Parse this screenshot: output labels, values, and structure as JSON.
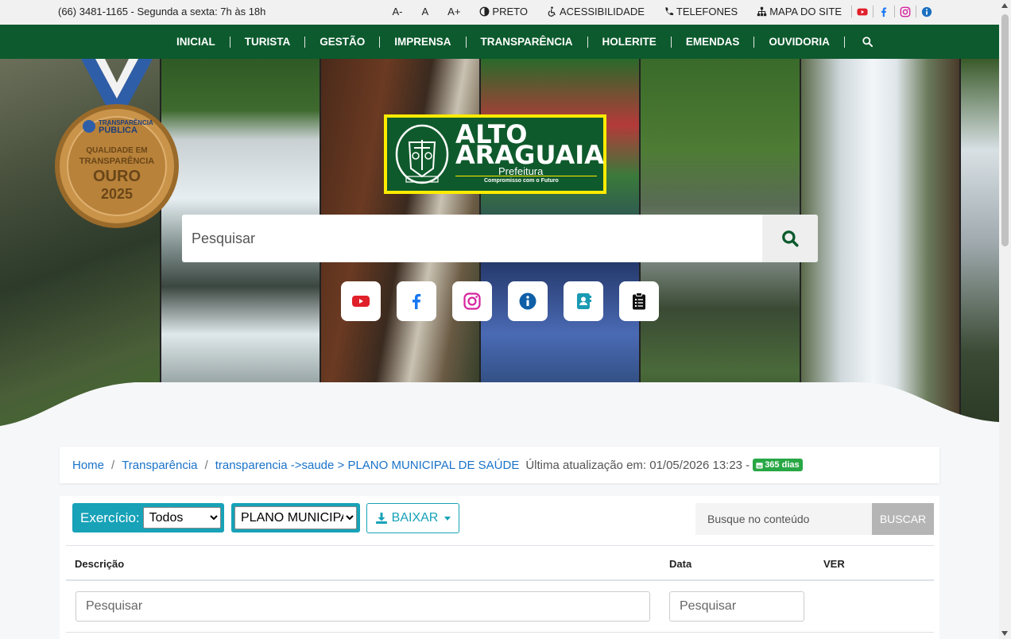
{
  "topbar": {
    "contact": "(66) 3481-1165 - Segunda a sexta: 7h às 18h",
    "font_decrease": "A-",
    "font_normal": "A",
    "font_increase": "A+",
    "contrast": "PRETO",
    "accessibility": "ACESSIBILIDADE",
    "phones": "TELEFONES",
    "sitemap": "MAPA DO SITE",
    "social": [
      "youtube-icon",
      "facebook-icon",
      "instagram-icon",
      "info-icon"
    ]
  },
  "nav": {
    "items": [
      "INICIAL",
      "TURISTA",
      "GESTÃO",
      "IMPRENSA",
      "TRANSPARÊNCIA",
      "HOLERITE",
      "EMENDAS",
      "OUVIDORIA"
    ]
  },
  "hero": {
    "medal": {
      "line1": "TRANSPARÊNCIA",
      "line2": "PÚBLICA",
      "line3": "QUALIDADE EM",
      "line4": "TRANSPARÊNCIA",
      "line5": "OURO",
      "line6": "2025"
    },
    "logo": {
      "line1": "ALTO",
      "line2": "ARAGUAIA",
      "line3": "Prefeitura",
      "line4": "Compromisso com o Futuro"
    },
    "search_placeholder": "Pesquisar",
    "quick_links": [
      "youtube-icon",
      "facebook-icon",
      "instagram-icon",
      "info-icon",
      "contacts-icon",
      "clipboard-icon"
    ]
  },
  "breadcrumb": {
    "home": "Home",
    "transparencia": "Transparência",
    "current": "transparencia ->saude > PLANO MUNICIPAL DE SAÚDE",
    "updated": "Última atualização em: 01/05/2026 13:23 -",
    "badge": "365 dias"
  },
  "filters": {
    "exercicio_label": "Exercício:",
    "exercicio_value": "Todos",
    "category_value": "PLANO MUNICIPAL",
    "download_label": "BAIXAR",
    "content_search_placeholder": "Busque no conteúdo",
    "content_search_button": "BUSCAR"
  },
  "table": {
    "headers": {
      "descricao": "Descrição",
      "data": "Data",
      "ver": "VER"
    },
    "filter_placeholder_desc": "Pesquisar",
    "filter_placeholder_date": "Pesquisar"
  },
  "colors": {
    "nav_green": "#0c5a2d",
    "accent_teal": "#17a2b8",
    "link_blue": "#1a73c9",
    "badge_green": "#28a745",
    "logo_yellow": "#ffeb00"
  }
}
